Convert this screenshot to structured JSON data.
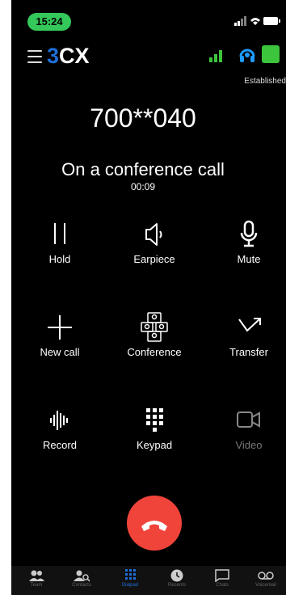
{
  "status_bar": {
    "time": "15:24"
  },
  "header": {
    "logo_prefix": "3",
    "logo_suffix": "CX",
    "connection_status": "Established"
  },
  "call": {
    "number": "700**040",
    "state": "On a conference call",
    "duration": "00:09"
  },
  "actions": {
    "hold": "Hold",
    "earpiece": "Earpiece",
    "mute": "Mute",
    "new_call": "New call",
    "conference": "Conference",
    "transfer": "Transfer",
    "record": "Record",
    "keypad": "Keypad",
    "video": "Video"
  },
  "tabs": [
    {
      "label": "Team"
    },
    {
      "label": "Contacts"
    },
    {
      "label": "Dialpad"
    },
    {
      "label": "Recents"
    },
    {
      "label": "Chats"
    },
    {
      "label": "Voicemail"
    }
  ],
  "colors": {
    "accent": "#1e6fd9",
    "hangup": "#f0443b",
    "presence": "#3cc43c",
    "time_pill": "#34c759"
  }
}
